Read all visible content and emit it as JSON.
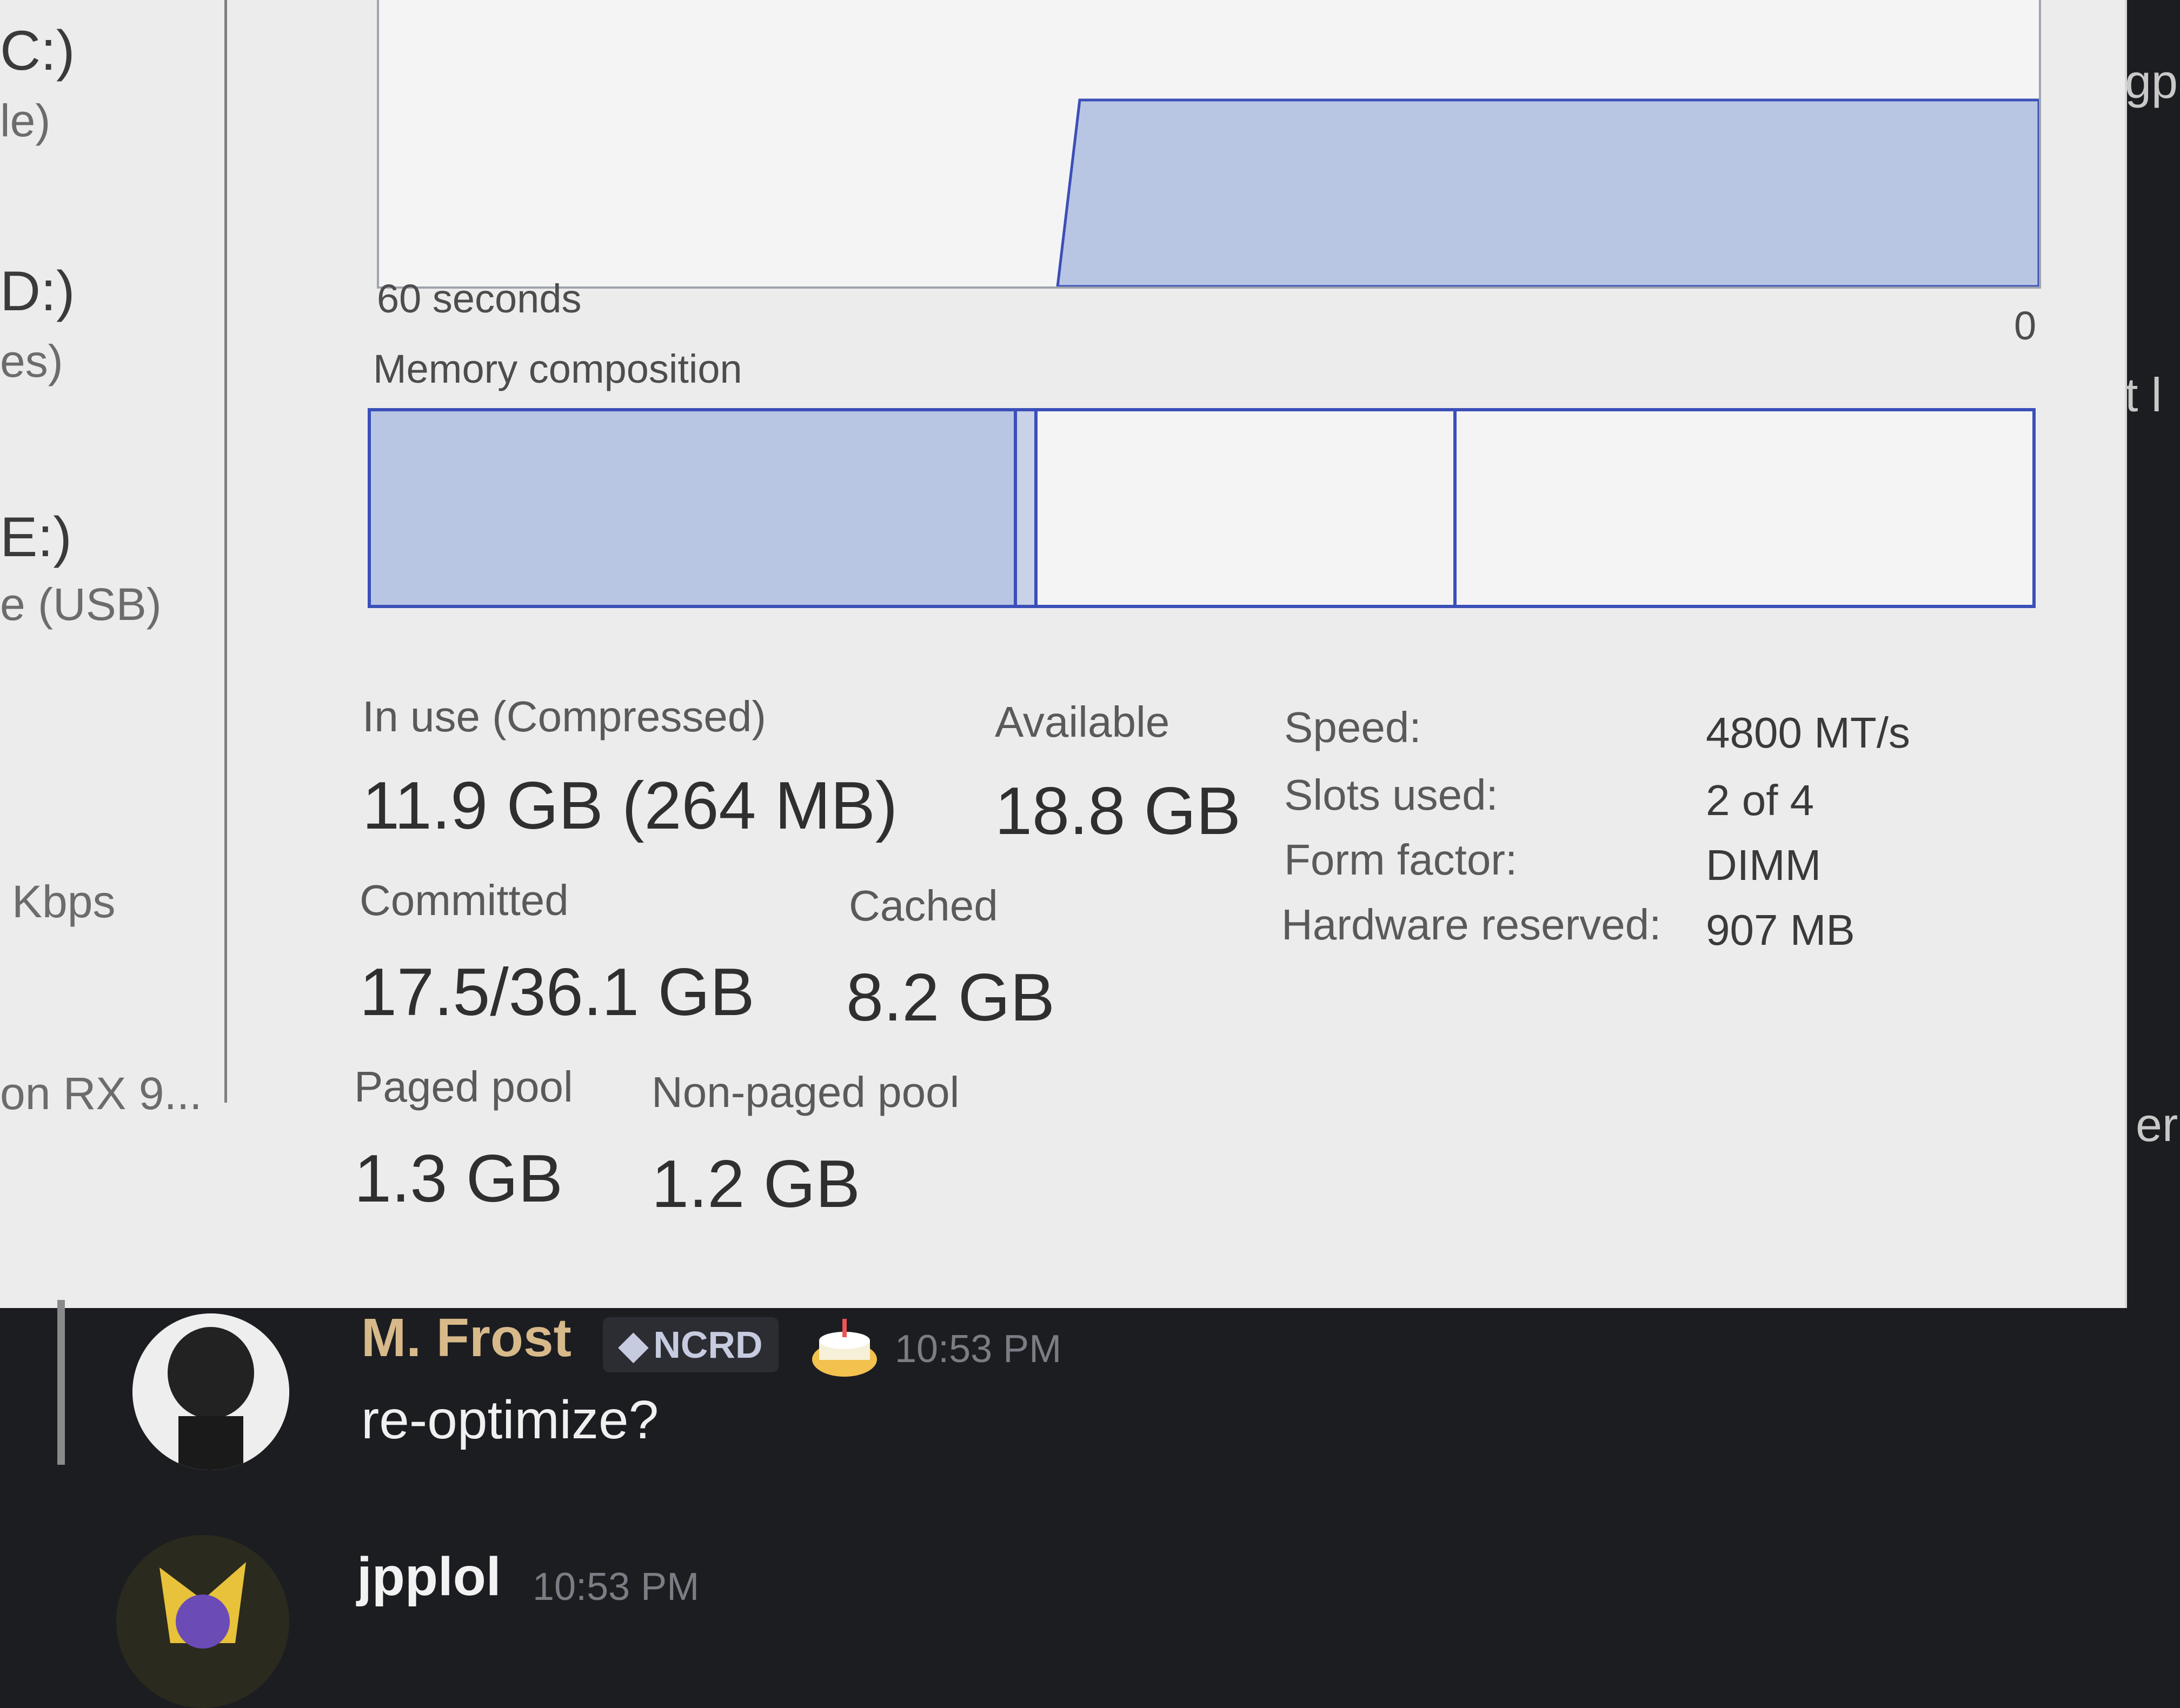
{
  "sidebar": {
    "items": [
      {
        "title": "C:)",
        "sub": "le)"
      },
      {
        "title": "D:)",
        "sub": "es)"
      },
      {
        "title": "E:)",
        "sub": "e (USB)"
      }
    ],
    "network_unit": "Kbps",
    "gpu_fragment": "on RX 9..."
  },
  "graph": {
    "time_label": "60 seconds",
    "zero_label": "0"
  },
  "composition": {
    "title": "Memory composition"
  },
  "stats": {
    "in_use_label": "In use (Compressed)",
    "in_use_value": "11.9 GB (264 MB)",
    "available_label": "Available",
    "available_value": "18.8 GB",
    "committed_label": "Committed",
    "committed_value": "17.5/36.1 GB",
    "cached_label": "Cached",
    "cached_value": "8.2 GB",
    "paged_label": "Paged pool",
    "paged_value": "1.3 GB",
    "nonpaged_label": "Non-paged pool",
    "nonpaged_value": "1.2 GB"
  },
  "specs": {
    "speed_label": "Speed:",
    "speed_value": "4800 MT/s",
    "slots_label": "Slots used:",
    "slots_value": "2 of 4",
    "form_label": "Form factor:",
    "form_value": "DIMM",
    "hw_label": "Hardware reserved:",
    "hw_value": "907 MB"
  },
  "right_fragments": [
    "gp",
    "t l",
    "er"
  ],
  "chat": {
    "messages": [
      {
        "author": "M. Frost",
        "author_color": "#d7b98a",
        "badge": "NCRD",
        "timestamp": "10:53 PM",
        "text": "re-optimize?"
      },
      {
        "author": "jpplol",
        "author_color": "#f2f2f2",
        "timestamp": "10:53 PM"
      }
    ]
  },
  "colors": {
    "accent": "#3b4fb8",
    "memory_fill": "#b8c6e4",
    "chat_bg": "#1c1d21"
  }
}
